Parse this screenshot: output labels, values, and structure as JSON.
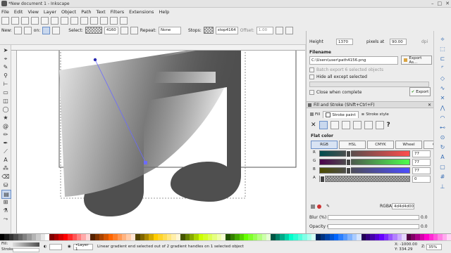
{
  "window": {
    "title": "*New document 1 - Inkscape",
    "controls": [
      "–",
      "□",
      "✕"
    ]
  },
  "menu": [
    "File",
    "Edit",
    "View",
    "Layer",
    "Object",
    "Path",
    "Text",
    "Filters",
    "Extensions",
    "Help"
  ],
  "tool_controls": {
    "new_label": "New:",
    "on_label": "on:",
    "select_label": "Select:",
    "select_value": "4160",
    "repeat_label": "Repeat:",
    "repeat_value": "None",
    "stops_label": "Stops:",
    "stops_value": "stop4164",
    "offset_label": "Offset:",
    "offset_value": "1.00"
  },
  "export": {
    "height_label": "Height",
    "height_value": "1370",
    "pixels_at_label": "pixels at",
    "dpi_value": "90.00",
    "dpi_unit": "dpi",
    "filename_label": "Filename",
    "filename_value": "C:\\Users\\user\\path4156.png",
    "export_as_label": "Export As...",
    "batch_label": "Batch export 6 selected objects",
    "hide_label": "Hide all except selected",
    "close_label": "Close when complete",
    "export_label": "Export"
  },
  "fill_stroke": {
    "title": "Fill and Stroke (Shift+Ctrl+F)",
    "tabs": [
      "Fill",
      "Stroke paint",
      "Stroke style"
    ],
    "flat_color_label": "Flat color",
    "modes": [
      "RGB",
      "HSL",
      "CMYK",
      "Wheel",
      "CMS"
    ],
    "channels": [
      {
        "label": "R",
        "value": "77"
      },
      {
        "label": "G",
        "value": "77"
      },
      {
        "label": "B",
        "value": "77"
      },
      {
        "label": "A",
        "value": "0"
      }
    ],
    "rgba_label": "RGBA:",
    "rgba_value": "4d4d4d00",
    "blur_label": "Blur (%)",
    "blur_value": "0.0",
    "opacity_label": "Opacity (%)",
    "opacity_value": "0.0"
  },
  "status": {
    "fill_label": "Fill:",
    "stroke_label": "Stroke:",
    "layer_value": "•Layer 1",
    "message": "Linear gradient end selected out of 2 gradient handles on 1 selected object",
    "coords_x": "X: -1000.00",
    "coords_y": "Y: 334.29",
    "zoom_label": "Z:",
    "zoom_value": "35%"
  },
  "palette_colors": [
    "#000000",
    "#1a1a1a",
    "#333333",
    "#4d4d4d",
    "#666666",
    "#808080",
    "#999999",
    "#b3b3b3",
    "#cccccc",
    "#e6e6e6",
    "#ffffff",
    "#800000",
    "#aa0000",
    "#d40000",
    "#ff0000",
    "#ff2a2a",
    "#ff5555",
    "#ff8080",
    "#ffaaaa",
    "#ffd5d5",
    "#552200",
    "#803300",
    "#aa4400",
    "#d45500",
    "#ff6600",
    "#ff7f2a",
    "#ff9955",
    "#ffb380",
    "#ffccaa",
    "#ffe6d5",
    "#554400",
    "#806600",
    "#aa8800",
    "#d4aa00",
    "#ffcc00",
    "#ffd42a",
    "#ffdd55",
    "#ffe680",
    "#ffeeaa",
    "#fff6d5",
    "#445500",
    "#668000",
    "#88aa00",
    "#aad400",
    "#ccff00",
    "#d4ff2a",
    "#ddff55",
    "#e5ff80",
    "#eeffaa",
    "#f6ffd5",
    "#225500",
    "#338000",
    "#44aa00",
    "#55d400",
    "#66ff00",
    "#7fff2a",
    "#99ff55",
    "#b3ff80",
    "#ccffaa",
    "#e5ffd5",
    "#005544",
    "#008066",
    "#00aa88",
    "#00d4aa",
    "#00ffcc",
    "#2affd5",
    "#55ffdd",
    "#80ffe6",
    "#aaffee",
    "#d5fff6",
    "#002255",
    "#003380",
    "#0044aa",
    "#0055d4",
    "#0066ff",
    "#2a7fff",
    "#5599ff",
    "#80b3ff",
    "#aaccff",
    "#d5e5ff",
    "#220055",
    "#330080",
    "#4400aa",
    "#5500d4",
    "#6600ff",
    "#7f2aff",
    "#9955ff",
    "#b380ff",
    "#ccaaff",
    "#e5d5ff",
    "#550044",
    "#800066",
    "#aa0088",
    "#d400aa",
    "#ff00cc",
    "#ff2ad4",
    "#ff55dd",
    "#ff80e5",
    "#ffaaee",
    "#ffd5f6"
  ]
}
